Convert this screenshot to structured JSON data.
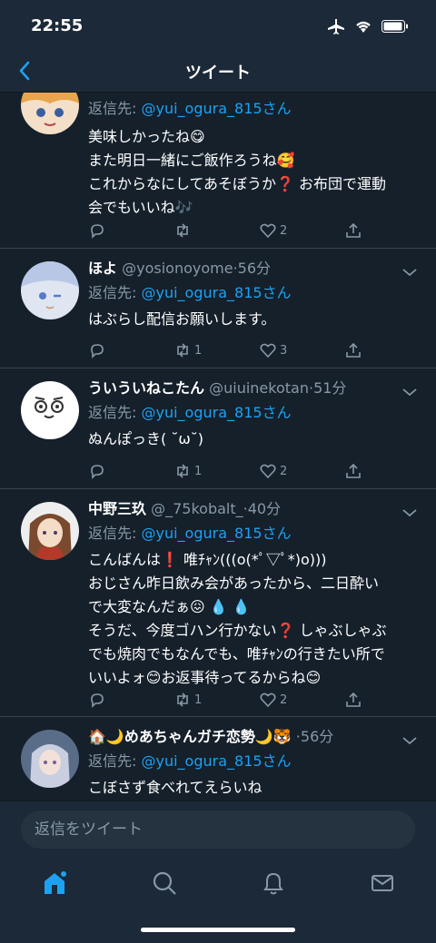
{
  "status_bar": {
    "time": "22:55"
  },
  "header": {
    "title": "ツイート"
  },
  "tweets": [
    {
      "display_name": "",
      "handle": "",
      "time_ago": "",
      "reply_prefix": "返信先:",
      "reply_to": "@yui_ogura_815さん",
      "lines": [
        "美味しかったね😋",
        "また明日一緒にご飯作ろうね🥰",
        "これからなにしてあそぼうか❓ お布団で運動",
        "会でもいいね🎶"
      ],
      "counts": {
        "reply": "",
        "retweet": "",
        "like": "2"
      }
    },
    {
      "display_name": "ほよ",
      "handle": "@yosionoyome",
      "time_ago": "56分",
      "reply_prefix": "返信先:",
      "reply_to": "@yui_ogura_815さん",
      "lines": [
        "はぶらし配信お願いします。"
      ],
      "counts": {
        "reply": "",
        "retweet": "1",
        "like": "3"
      }
    },
    {
      "display_name": "ういういねこたん",
      "handle": "@uiuinekotan",
      "time_ago": "51分",
      "reply_prefix": "返信先:",
      "reply_to": "@yui_ogura_815さん",
      "lines": [
        "ぬんぽっき( ˘ω˘)"
      ],
      "counts": {
        "reply": "",
        "retweet": "1",
        "like": "2"
      }
    },
    {
      "display_name": "中野三玖",
      "handle": "@_75kobalt_",
      "time_ago": "40分",
      "reply_prefix": "返信先:",
      "reply_to": "@yui_ogura_815さん",
      "lines": [
        "こんばんは❗ 唯ﾁｬﾝ(((o(*ﾟ▽ﾟ*)o)))",
        "おじさん昨日飲み会があったから、二日酔い",
        "で大変なんだぁ😖 💧 💧",
        "そうだ、今度ゴハン行かない❓ しゃぶしゃぶ",
        "でも焼肉でもなんでも、唯ﾁｬﾝの行きたい所で",
        "いいよォ😊お返事待ってるからね😊"
      ],
      "counts": {
        "reply": "",
        "retweet": "1",
        "like": "2"
      }
    },
    {
      "display_name": "🏠🌙めあちゃんガチ恋勢🌙🐯",
      "handle": "",
      "time_ago": "56分",
      "reply_prefix": "返信先:",
      "reply_to": "@yui_ogura_815さん",
      "lines": [
        "こぼさず食べれてえらいね"
      ],
      "counts": {
        "reply": "",
        "retweet": "",
        "like": ""
      }
    }
  ],
  "separator": "·",
  "compose": {
    "placeholder": "返信をツイート"
  },
  "tabbar": {
    "items": [
      "home-icon",
      "search-icon",
      "bell-icon",
      "mail-icon"
    ]
  },
  "colors": {
    "accent": "#1da1f2",
    "background": "#15202b",
    "bar": "#1c2938",
    "muted": "#8899a6"
  }
}
